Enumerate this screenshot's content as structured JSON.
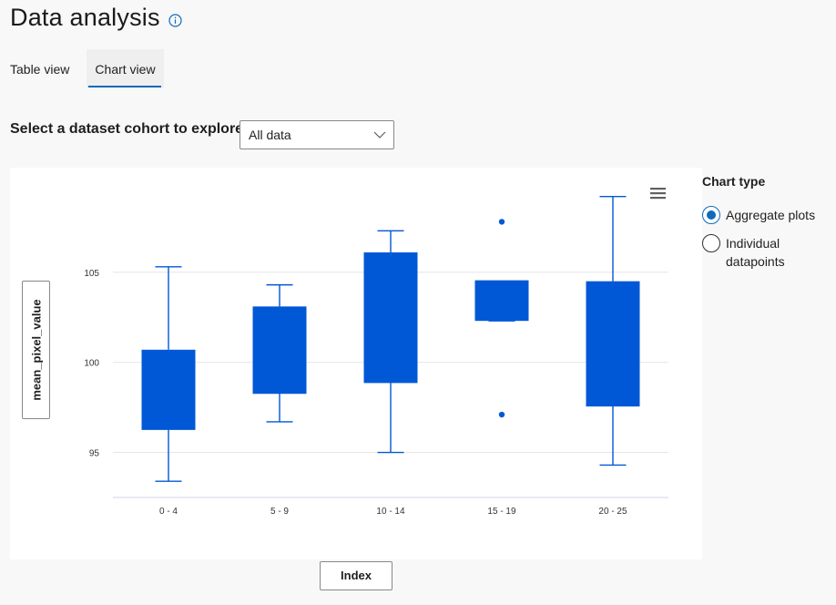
{
  "header": {
    "title": "Data analysis"
  },
  "tabs": [
    {
      "label": "Table view",
      "selected": false
    },
    {
      "label": "Chart view",
      "selected": true
    }
  ],
  "cohort": {
    "label": "Select a dataset cohort to explore",
    "selected": "All data"
  },
  "axis_buttons": {
    "y": "mean_pixel_value",
    "x": "Index"
  },
  "chart_type": {
    "title": "Chart type",
    "options": [
      {
        "label": "Aggregate plots",
        "selected": true
      },
      {
        "label": "Individual datapoints",
        "selected": false
      }
    ]
  },
  "colors": {
    "box": "#0058d6",
    "accent": "#0f6cbd"
  },
  "chart_data": {
    "type": "box",
    "categories": [
      "0 - 4",
      "5 - 9",
      "10 - 14",
      "15 - 19",
      "20 - 25"
    ],
    "boxes": [
      {
        "min": 93.4,
        "q1": 96.3,
        "median": 96.3,
        "q3": 100.7,
        "max": 105.3,
        "outliers": []
      },
      {
        "min": 96.7,
        "q1": 98.3,
        "median": 98.3,
        "q3": 103.1,
        "max": 104.3,
        "outliers": []
      },
      {
        "min": 95.0,
        "q1": 98.9,
        "median": 98.9,
        "q3": 106.1,
        "max": 107.3,
        "outliers": []
      },
      {
        "min": 102.3,
        "q1": 102.3,
        "median": 104.5,
        "q3": 104.5,
        "max": 104.5,
        "outliers": [
          107.8,
          97.1
        ]
      },
      {
        "min": 94.3,
        "q1": 97.6,
        "median": 97.6,
        "q3": 104.5,
        "max": 109.2,
        "outliers": []
      }
    ],
    "y_ticks": [
      95,
      100,
      105
    ],
    "ylim": [
      92.5,
      110.5
    ],
    "grid": true
  }
}
